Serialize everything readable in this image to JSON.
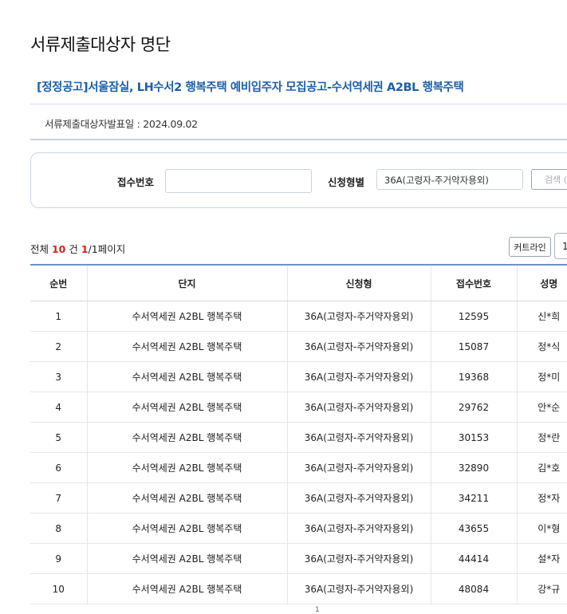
{
  "page_title": "서류제출대상자 명단",
  "notice_title": "[정정공고]서울잠실, LH수서2 행복주택 예비입주자 모집공고-수서역세권 A2BL 행복주택",
  "announce_date": "서류제출대상자발표일 : 2024.09.02",
  "search": {
    "receipt_label": "접수번호",
    "receipt_value": "",
    "type_label": "신청형별",
    "type_selected": "36A(고령자-주거약자용외)",
    "search_button": "검색 ("
  },
  "summary": {
    "prefix": "전체 ",
    "total": "10",
    "unit": " 건 ",
    "current_page": "1",
    "pages_suffix": "/1페이지"
  },
  "toolbar": {
    "curtain_label": "커트라인",
    "page_size": "1"
  },
  "table": {
    "columns": [
      "순번",
      "단지",
      "신청형",
      "접수번호",
      "성명"
    ],
    "rows": [
      [
        "1",
        "수서역세권 A2BL 행복주택",
        "36A(고령자-주거약자용외)",
        "12595",
        "신*희"
      ],
      [
        "2",
        "수서역세권 A2BL 행복주택",
        "36A(고령자-주거약자용외)",
        "15087",
        "정*식"
      ],
      [
        "3",
        "수서역세권 A2BL 행복주택",
        "36A(고령자-주거약자용외)",
        "19368",
        "정*미"
      ],
      [
        "4",
        "수서역세권 A2BL 행복주택",
        "36A(고령자-주거약자용외)",
        "29762",
        "안*순"
      ],
      [
        "5",
        "수서역세권 A2BL 행복주택",
        "36A(고령자-주거약자용외)",
        "30153",
        "정*란"
      ],
      [
        "6",
        "수서역세권 A2BL 행복주택",
        "36A(고령자-주거약자용외)",
        "32890",
        "김*호"
      ],
      [
        "7",
        "수서역세권 A2BL 행복주택",
        "36A(고령자-주거약자용외)",
        "34211",
        "정*자"
      ],
      [
        "8",
        "수서역세권 A2BL 행복주택",
        "36A(고령자-주거약자용외)",
        "43655",
        "이*형"
      ],
      [
        "9",
        "수서역세권 A2BL 행복주택",
        "36A(고령자-주거약자용외)",
        "44414",
        "설*자"
      ],
      [
        "10",
        "수서역세권 A2BL 행복주택",
        "36A(고령자-주거약자용외)",
        "48084",
        "강*규"
      ]
    ]
  },
  "pagination": {
    "current": "1"
  }
}
